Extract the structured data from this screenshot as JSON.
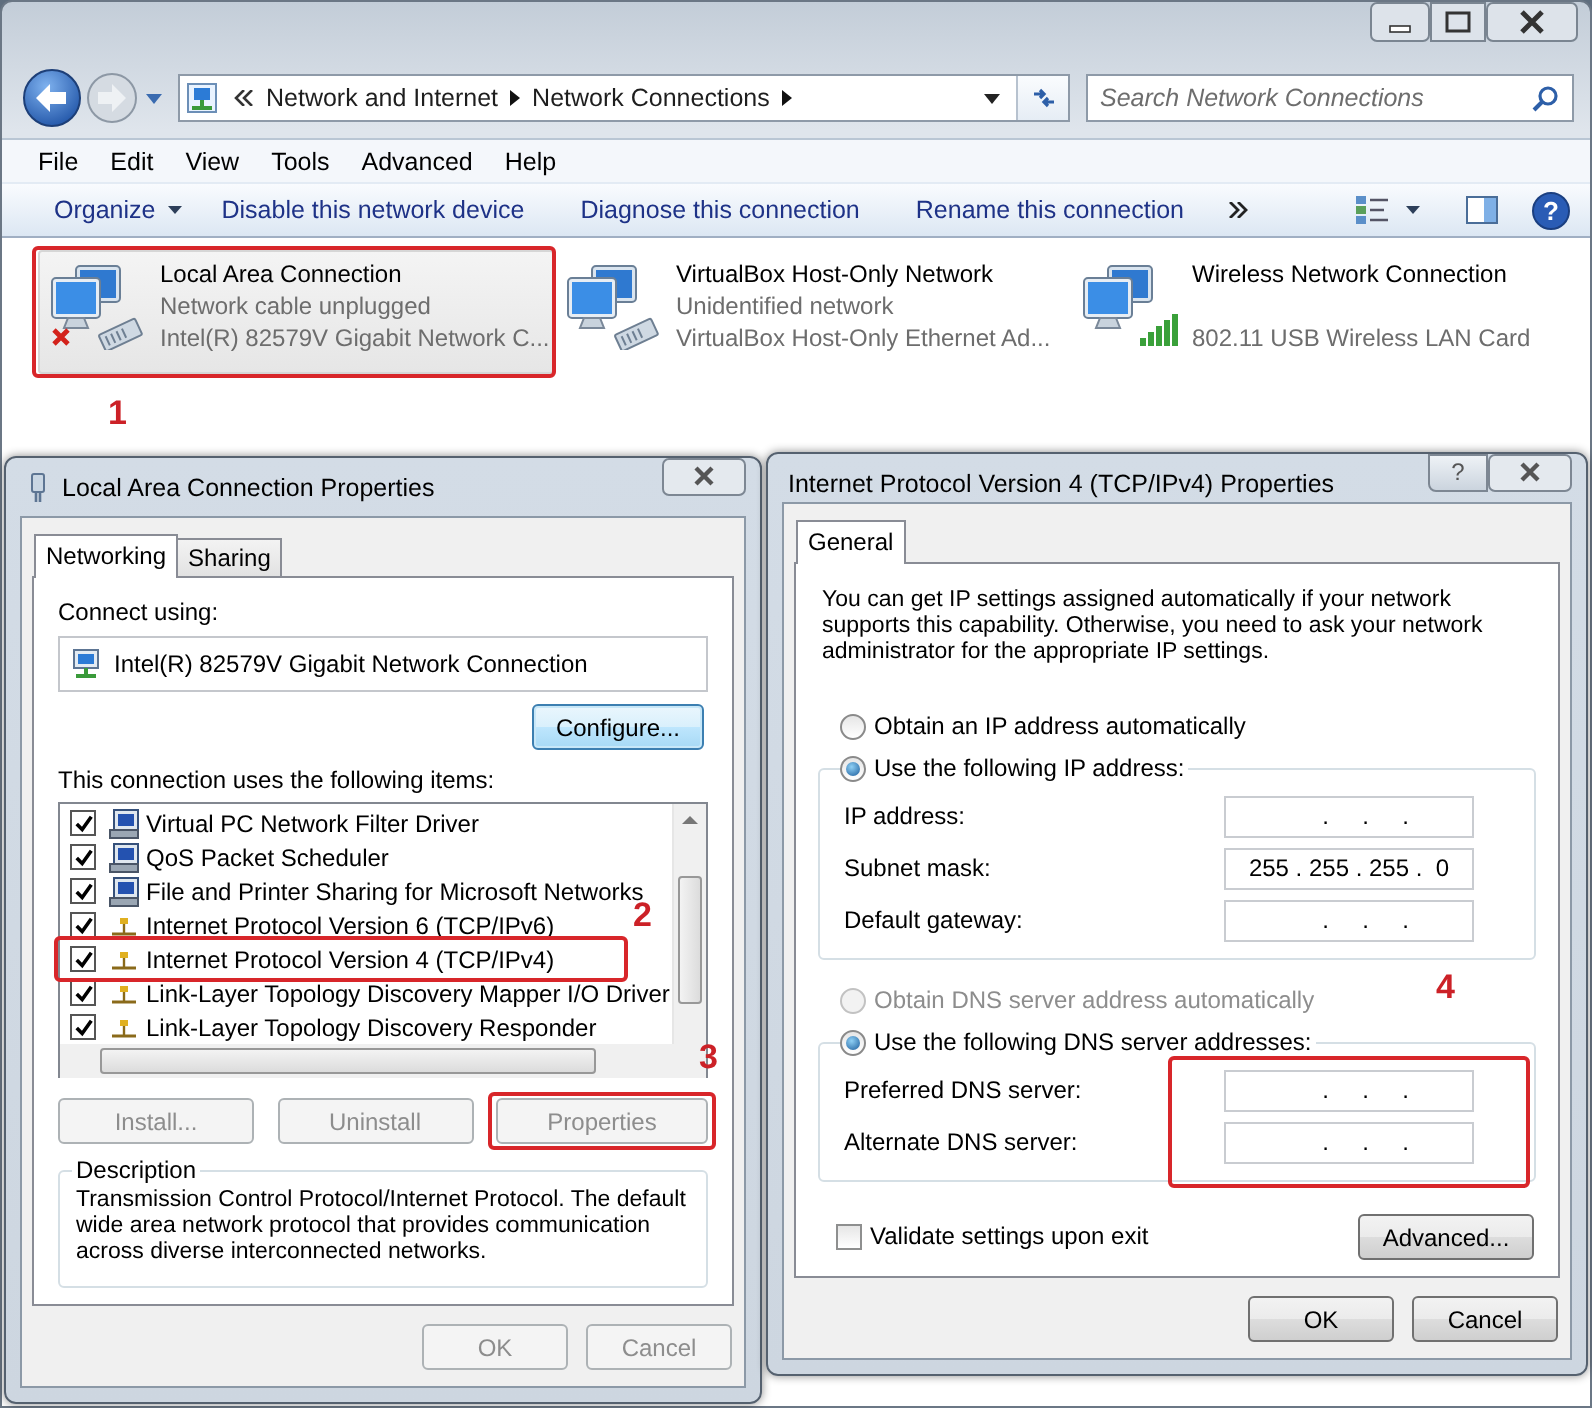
{
  "explorer": {
    "breadcrumb": [
      "Network and Internet",
      "Network Connections"
    ],
    "search": {
      "placeholder": "Search Network Connections"
    },
    "menu": [
      "File",
      "Edit",
      "View",
      "Tools",
      "Advanced",
      "Help"
    ],
    "help_icon": "?",
    "commands": [
      {
        "label": "Organize",
        "dropdown": true
      },
      {
        "label": "Disable this network device",
        "dropdown": false
      },
      {
        "label": "Diagnose this connection",
        "dropdown": false
      },
      {
        "label": "Rename this connection",
        "dropdown": false
      }
    ],
    "connections": [
      {
        "name": "Local Area Connection",
        "status": "Network cable unplugged",
        "device": "Intel(R) 82579V Gigabit Network C...",
        "kind": "wired",
        "unplugged": true,
        "selected": true,
        "annotation": "1"
      },
      {
        "name": "VirtualBox Host-Only Network",
        "status": "Unidentified network",
        "device": "VirtualBox Host-Only Ethernet Ad...",
        "kind": "wired",
        "unplugged": false,
        "selected": false
      },
      {
        "name": "Wireless Network Connection",
        "device": "802.11 USB Wireless LAN Card",
        "kind": "wireless",
        "unplugged": false,
        "selected": false
      }
    ]
  },
  "lan_dialog": {
    "title": "Local Area Connection Properties",
    "tabs": [
      {
        "label": "Networking",
        "selected": true
      },
      {
        "label": "Sharing",
        "selected": false
      }
    ],
    "connect_label": "Connect using:",
    "adapter": "Intel(R) 82579V Gigabit Network Connection",
    "configure_button": "Configure...",
    "items_label": "This connection uses the following items:",
    "items": [
      {
        "label": "Virtual PC Network Filter Driver",
        "checked": true,
        "kind": "service"
      },
      {
        "label": "QoS Packet Scheduler",
        "checked": true,
        "kind": "service"
      },
      {
        "label": "File and Printer Sharing for Microsoft Networks",
        "checked": true,
        "kind": "service"
      },
      {
        "label": "Internet Protocol Version 6 (TCP/IPv6)",
        "checked": true,
        "kind": "protocol"
      },
      {
        "label": "Internet Protocol Version 4 (TCP/IPv4)",
        "checked": true,
        "kind": "protocol",
        "annotation": "2"
      },
      {
        "label": "Link-Layer Topology Discovery Mapper I/O Driver",
        "checked": true,
        "kind": "protocol"
      },
      {
        "label": "Link-Layer Topology Discovery Responder",
        "checked": true,
        "kind": "protocol"
      }
    ],
    "actions": [
      {
        "label": "Install...",
        "disabled": true
      },
      {
        "label": "Uninstall",
        "disabled": true
      },
      {
        "label": "Properties",
        "disabled": true,
        "annotation": "3"
      }
    ],
    "description_title": "Description",
    "description": "Transmission Control Protocol/Internet Protocol. The default wide area network protocol that provides communication across diverse interconnected networks.",
    "footer": [
      {
        "label": "OK",
        "disabled": true
      },
      {
        "label": "Cancel",
        "disabled": true
      }
    ]
  },
  "ipv4_dialog": {
    "title": "Internet Protocol Version 4 (TCP/IPv4) Properties",
    "help_button": "?",
    "tabs": [
      {
        "label": "General",
        "selected": true
      }
    ],
    "intro": "You can get IP settings assigned automatically if your network supports this capability. Otherwise, you need to ask your network administrator for the appropriate IP settings.",
    "ip_mode": [
      {
        "label": "Obtain an IP address automatically",
        "selected": false,
        "disabled": false
      },
      {
        "label": "Use the following IP address:",
        "selected": true,
        "disabled": false
      }
    ],
    "ip_fields": [
      {
        "label": "IP address:",
        "value": "     .     .     ."
      },
      {
        "label": "Subnet mask:",
        "value": "255 . 255 . 255 .  0"
      },
      {
        "label": "Default gateway:",
        "value": "     .     .     ."
      }
    ],
    "dns_mode": [
      {
        "label": "Obtain DNS server address automatically",
        "selected": false,
        "disabled": true
      },
      {
        "label": "Use the following DNS server addresses:",
        "selected": true,
        "disabled": false
      }
    ],
    "dns_fields": [
      {
        "label": "Preferred DNS server:",
        "value": "     .     .     ."
      },
      {
        "label": "Alternate DNS server:",
        "value": "     .     .     ."
      }
    ],
    "dns_annotation": "4",
    "validate": {
      "label": "Validate settings upon exit",
      "checked": false
    },
    "advanced_button": "Advanced...",
    "footer": [
      {
        "label": "OK",
        "disabled": false
      },
      {
        "label": "Cancel",
        "disabled": false
      }
    ]
  }
}
